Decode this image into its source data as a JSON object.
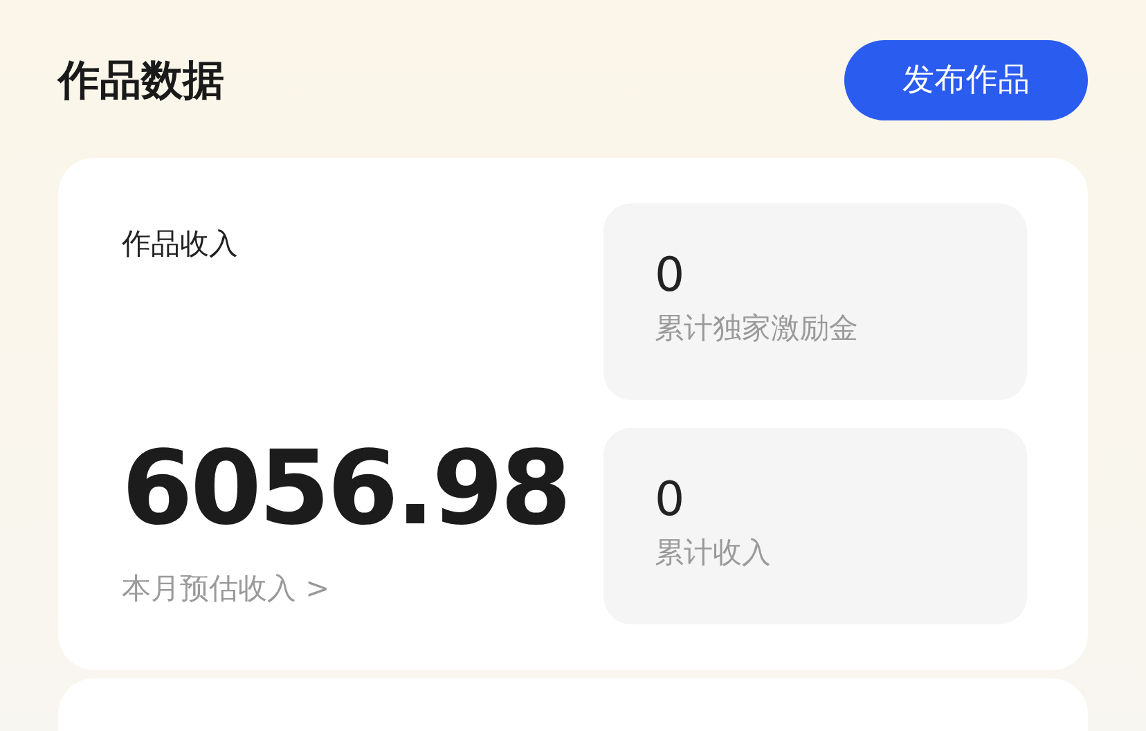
{
  "header": {
    "title": "作品数据",
    "publish_button": "发布作品"
  },
  "income_card": {
    "label": "作品收入",
    "amount": "6056.98",
    "amount_link": "本月预估收入 >",
    "stats": [
      {
        "value": "0",
        "label": "累计独家激励金"
      },
      {
        "value": "0",
        "label": "累计收入"
      }
    ]
  }
}
